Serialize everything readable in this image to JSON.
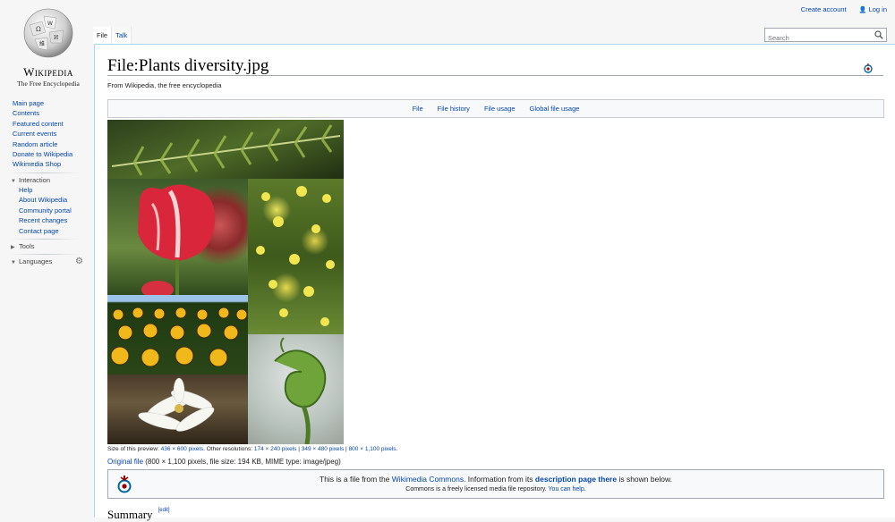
{
  "logo": {
    "wordmark": "Wikipedia",
    "tagline": "The Free Encyclopedia"
  },
  "personal": {
    "create_account": "Create account",
    "log_in": "Log in",
    "user_icon": "user-icon"
  },
  "tabs": [
    {
      "label": "File"
    },
    {
      "label": "Talk"
    }
  ],
  "search": {
    "placeholder": "Search",
    "icon": "search-icon"
  },
  "sidebar": {
    "main": [
      {
        "label": "Main page"
      },
      {
        "label": "Contents"
      },
      {
        "label": "Featured content"
      },
      {
        "label": "Current events"
      },
      {
        "label": "Random article"
      },
      {
        "label": "Donate to Wikipedia"
      },
      {
        "label": "Wikimedia Shop"
      }
    ],
    "interaction": {
      "heading": "Interaction",
      "items": [
        {
          "label": "Help"
        },
        {
          "label": "About Wikipedia"
        },
        {
          "label": "Community portal"
        },
        {
          "label": "Recent changes"
        },
        {
          "label": "Contact page"
        }
      ]
    },
    "tools": {
      "heading": "Tools"
    },
    "languages": {
      "heading": "Languages",
      "icon": "gear-icon"
    }
  },
  "page": {
    "title": "File:Plants diversity.jpg",
    "tagline": "From Wikipedia, the free encyclopedia",
    "filetoc": [
      {
        "label": "File"
      },
      {
        "label": "File history"
      },
      {
        "label": "File usage"
      },
      {
        "label": "Global file usage"
      }
    ]
  },
  "file": {
    "preview_prefix": "Size of this preview: ",
    "preview_size": "436 × 600 pixels",
    "other_res_label": ". Other resolutions: ",
    "res1": "174 × 240 pixels",
    "res2": "349 × 480 pixels",
    "res3": "800 × 1,100 pixels",
    "sep": " | ",
    "end": ".",
    "original_link": "Original file",
    "original_details": " (800 × 1,100 pixels, file size: 194 KB, MIME type: image/jpeg)"
  },
  "commons": {
    "l1_a": "This is a file from the ",
    "l1_link": "Wikimedia Commons",
    "l1_b": ". Information from its ",
    "l1_link2": "description page there",
    "l1_c": " is shown below.",
    "l2_a": "Commons is a freely licensed media file repository. ",
    "l2_link": "You can help",
    "l2_b": "."
  },
  "summary": {
    "heading": "Summary",
    "edit": "[edit]"
  },
  "colors": {
    "link": "#0645ad",
    "content_border": "#a7d7f9",
    "sidebar_bg": "#f6f6f6"
  }
}
